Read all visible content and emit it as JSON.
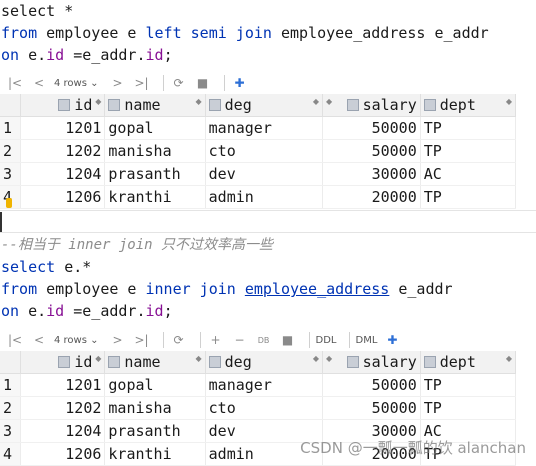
{
  "editor": {
    "q1_line1": "select *",
    "q1_line2": {
      "kw": "from",
      "t1": " employee e ",
      "kw2": "left semi join",
      "t2": " employee_address e_addr"
    },
    "q1_line3": {
      "kw": "on",
      "t1": " e.",
      "f1": "id",
      "t2": " =e_addr.",
      "f2": "id",
      "t3": ";"
    },
    "comment": "--相当于 inner join 只不过效率高一些",
    "q2_line1": {
      "kw": "select",
      "t1": " e.*"
    },
    "q2_line2": {
      "kw": "from",
      "t1": " employee e ",
      "kw2": "inner join",
      "t2": " ",
      "link": "employee_address",
      "t3": " e_addr"
    },
    "q2_line3": {
      "kw": "on",
      "t1": " e.",
      "f1": "id",
      "t2": " =e_addr.",
      "f2": "id",
      "t3": ";"
    }
  },
  "toolbar1": {
    "rows": "4 rows"
  },
  "toolbar2": {
    "rows": "4 rows",
    "ddl": "DDL",
    "dml": "DML"
  },
  "columns": [
    "id",
    "name",
    "deg",
    "salary",
    "dept"
  ],
  "rows": [
    {
      "n": "1",
      "id": "1201",
      "name": "gopal",
      "deg": "manager",
      "salary": "50000",
      "dept": "TP"
    },
    {
      "n": "2",
      "id": "1202",
      "name": "manisha",
      "deg": "cto",
      "salary": "50000",
      "dept": "TP"
    },
    {
      "n": "3",
      "id": "1204",
      "name": "prasanth",
      "deg": "dev",
      "salary": "30000",
      "dept": "AC"
    },
    {
      "n": "4",
      "id": "1206",
      "name": "kranthi",
      "deg": "admin",
      "salary": "20000",
      "dept": "TP"
    }
  ],
  "watermark": "CSDN @一瓢一瓢的饮 alanchan",
  "colors": {
    "keyword": "#0033b3",
    "field": "#871094",
    "comment": "#8c8c8c"
  }
}
